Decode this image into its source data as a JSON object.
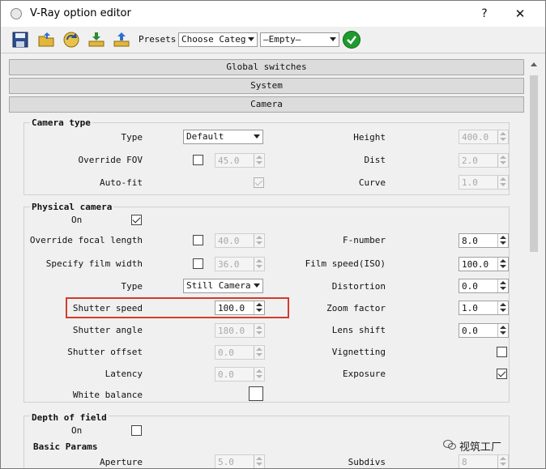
{
  "window": {
    "title": "V-Ray option editor",
    "help": "?",
    "close": "✕"
  },
  "toolbar": {
    "presets_label": "Presets:",
    "category_combo": "Choose Category",
    "preset_combo": "—Empty—"
  },
  "rollouts": {
    "global": "Global switches",
    "system": "System",
    "camera": "Camera"
  },
  "camera_type": {
    "title": "Camera type",
    "type_label": "Type",
    "type_value": "Default",
    "override_fov_label": "Override FOV",
    "override_fov_value": "45.0",
    "autofit_label": "Auto-fit",
    "height_label": "Height",
    "height_value": "400.0",
    "dist_label": "Dist",
    "dist_value": "2.0",
    "curve_label": "Curve",
    "curve_value": "1.0"
  },
  "physical_camera": {
    "title": "Physical camera",
    "on_label": "On",
    "override_focal_label": "Override focal length",
    "override_focal_value": "40.0",
    "film_width_label": "Specify film width",
    "film_width_value": "36.0",
    "type_label": "Type",
    "type_value": "Still Camera",
    "shutter_speed_label": "Shutter speed",
    "shutter_speed_value": "100.0",
    "shutter_angle_label": "Shutter angle",
    "shutter_angle_value": "180.0",
    "shutter_offset_label": "Shutter offset",
    "shutter_offset_value": "0.0",
    "latency_label": "Latency",
    "latency_value": "0.0",
    "white_balance_label": "White balance",
    "fnumber_label": "F-number",
    "fnumber_value": "8.0",
    "film_speed_label": "Film speed(ISO)",
    "film_speed_value": "100.0",
    "distortion_label": "Distortion",
    "distortion_value": "0.0",
    "zoom_label": "Zoom factor",
    "zoom_value": "1.0",
    "lens_shift_label": "Lens shift",
    "lens_shift_value": "0.0",
    "vignetting_label": "Vignetting",
    "exposure_label": "Exposure"
  },
  "depth_of_field": {
    "title": "Depth of field",
    "on_label": "On",
    "basic_params": "Basic Params",
    "aperture_label": "Aperture",
    "aperture_value": "5.0",
    "subdivs_label": "Subdivs",
    "subdivs_value": "8"
  },
  "watermark": "视筑工厂",
  "colors": {
    "highlight": "#d23c2c",
    "ok": "#1e9b2e"
  }
}
